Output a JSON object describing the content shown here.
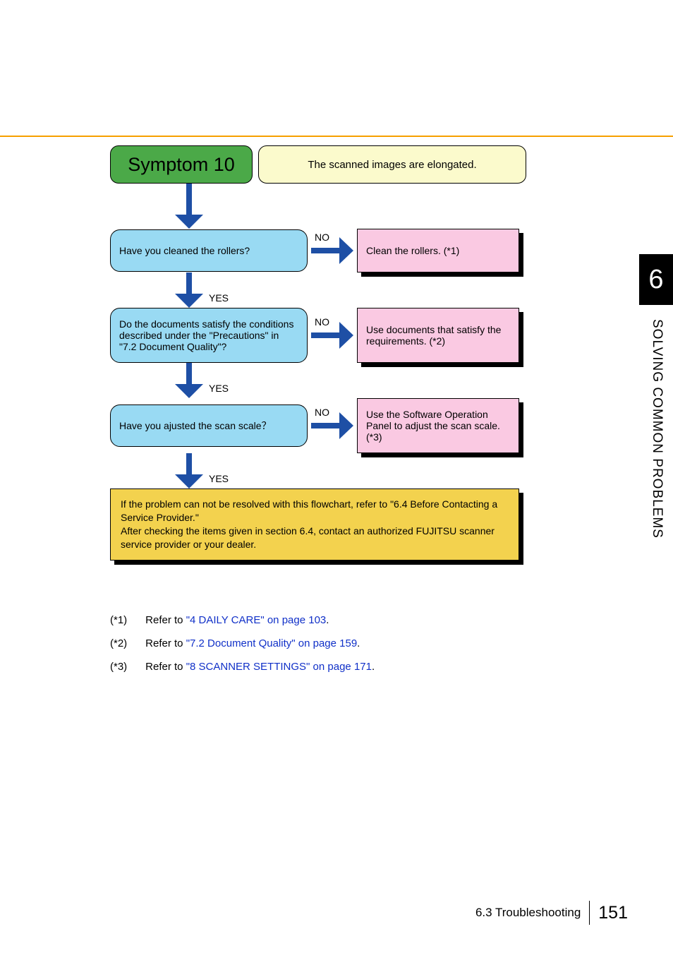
{
  "header": {
    "symptom_number": "Symptom 10",
    "symptom_desc": "The scanned images are elongated."
  },
  "steps": [
    {
      "question": "Have you cleaned the rollers?",
      "no_label": "NO",
      "yes_label": "YES",
      "action": "Clean the rollers. (*1)"
    },
    {
      "question": "Do the documents satisfy the conditions described under the \"Precautions\" in \"7.2 Document Quality\"?",
      "no_label": "NO",
      "yes_label": "YES",
      "action": "Use documents that satisfy the requirements. (*2)"
    },
    {
      "question": "Have you ajusted the scan scale？",
      "no_label": "NO",
      "yes_label": "YES",
      "action": "Use the Software Operation Panel to adjust the scan scale. (*3)"
    }
  ],
  "final": "If the problem can not be resolved with this flowchart, refer to \"6.4 Before Contacting a Service Provider.\"\nAfter checking the items given in section 6.4, contact an authorized FUJITSU scanner service provider or your dealer.",
  "footnotes": [
    {
      "num": "(*1)",
      "prefix": "Refer to ",
      "link": "\"4  DAILY CARE\" on page 103",
      "suffix": "."
    },
    {
      "num": "(*2)",
      "prefix": "Refer to ",
      "link": "\"7.2 Document Quality\" on page 159",
      "suffix": "."
    },
    {
      "num": "(*3)",
      "prefix": "Refer to ",
      "link": "\"8 SCANNER SETTINGS\" on page 171",
      "suffix": "."
    }
  ],
  "sidebar": {
    "chapter": "6",
    "title": "SOLVING COMMON PROBLEMS"
  },
  "footer": {
    "section": "6.3 Troubleshooting",
    "page": "151"
  }
}
